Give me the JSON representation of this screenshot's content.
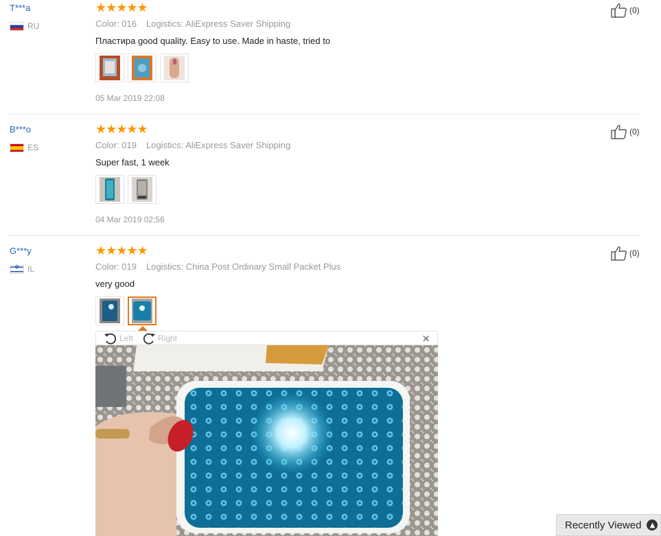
{
  "reviews": [
    {
      "user": "T***a",
      "country": "RU",
      "stars": "★★★★★",
      "color": "Color: 016",
      "logistics": "Logistics: AliExpress Saver Shipping",
      "text": "Пластира good quality. Easy to use. Made in haste, tried to",
      "date": "05 Mar 2019 22:08",
      "likes": "(0)"
    },
    {
      "user": "B***o",
      "country": "ES",
      "stars": "★★★★★",
      "color": "Color: 019",
      "logistics": "Logistics: AliExpress Saver Shipping",
      "text": "Super fast, 1 week",
      "date": "04 Mar 2019 02:56",
      "likes": "(0)"
    },
    {
      "user": "G***y",
      "country": "IL",
      "stars": "★★★★★",
      "color": "Color: 019",
      "logistics": "Logistics: China Post Ordinary Small Packet Plus",
      "text": "very good",
      "likes": "(0)"
    }
  ],
  "viewer": {
    "rotate_left": "Left",
    "rotate_right": "Right",
    "close": "×"
  },
  "recently_viewed": "Recently Viewed",
  "icons": {
    "star": "star-icon",
    "like": "thumbs-up-icon",
    "rotate_left": "rotate-left-icon",
    "rotate_right": "rotate-right-icon",
    "close": "close-icon",
    "up": "chevron-up-icon"
  },
  "colors": {
    "star": "#ff9600",
    "username": "#2266b8",
    "active_thumb": "#e3791b"
  }
}
